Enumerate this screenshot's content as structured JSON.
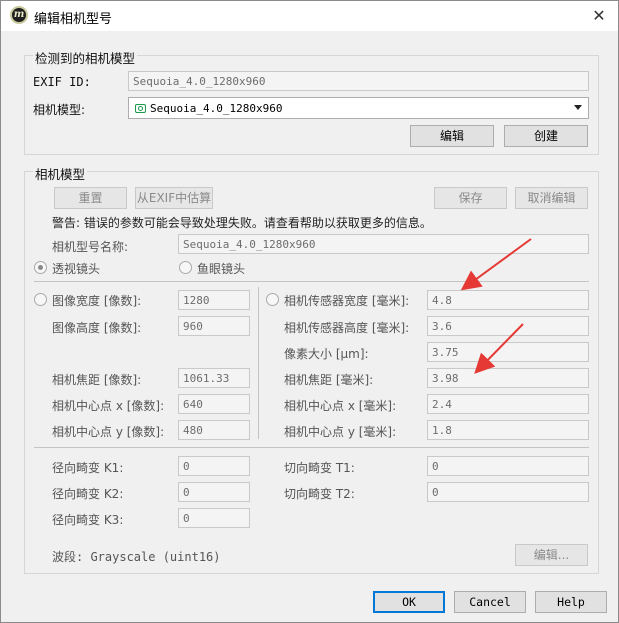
{
  "window": {
    "title": "编辑相机型号",
    "app_icon_letter": "m"
  },
  "detected": {
    "title": "检测到的相机模型",
    "exif_label": "EXIF ID:",
    "exif_value": "Sequoia_4.0_1280x960",
    "model_label": "相机模型:",
    "model_value": "Sequoia_4.0_1280x960",
    "edit_btn": "编辑",
    "create_btn": "创建"
  },
  "model": {
    "title": "相机模型",
    "reset_btn": "重置",
    "exif_estimate_btn": "从EXIF中估算",
    "save_btn": "保存",
    "cancel_edit_btn": "取消编辑",
    "warning": "警告: 错误的参数可能会导致处理失败。请查看帮助以获取更多的信息。",
    "name_label": "相机型号名称:",
    "name_value": "Sequoia_4.0_1280x960",
    "lens_perspective": "透视镜头",
    "lens_fisheye": "鱼眼镜头",
    "px": {
      "width_label": "图像宽度 [像数]:",
      "width_value": "1280",
      "height_label": "图像高度 [像数]:",
      "height_value": "960",
      "focal_label": "相机焦距 [像数]:",
      "focal_value": "1061.33",
      "cx_label": "相机中心点 x [像数]:",
      "cx_value": "640",
      "cy_label": "相机中心点 y [像数]:",
      "cy_value": "480"
    },
    "mm": {
      "sensor_w_label": "相机传感器宽度 [毫米]:",
      "sensor_w_value": "4.8",
      "sensor_h_label": "相机传感器高度 [毫米]:",
      "sensor_h_value": "3.6",
      "pixel_label": "像素大小 [μm]:",
      "pixel_value": "3.75",
      "focal_label": "相机焦距 [毫米]:",
      "focal_value": "3.98",
      "cx_label": "相机中心点 x [毫米]:",
      "cx_value": "2.4",
      "cy_label": "相机中心点 y [毫米]:",
      "cy_value": "1.8"
    },
    "distortion": {
      "k1_label": "径向畸变 K1:",
      "k1_value": "0",
      "k2_label": "径向畸变 K2:",
      "k2_value": "0",
      "k3_label": "径向畸变 K3:",
      "k3_value": "0",
      "t1_label": "切向畸变 T1:",
      "t1_value": "0",
      "t2_label": "切向畸变 T2:",
      "t2_value": "0"
    },
    "band_label": "波段: Grayscale (uint16)",
    "band_edit_btn": "编辑..."
  },
  "footer": {
    "ok": "OK",
    "cancel": "Cancel",
    "help": "Help"
  },
  "colors": {
    "annotation_arrow": "#e53935",
    "default_button_border": "#0078d7"
  }
}
